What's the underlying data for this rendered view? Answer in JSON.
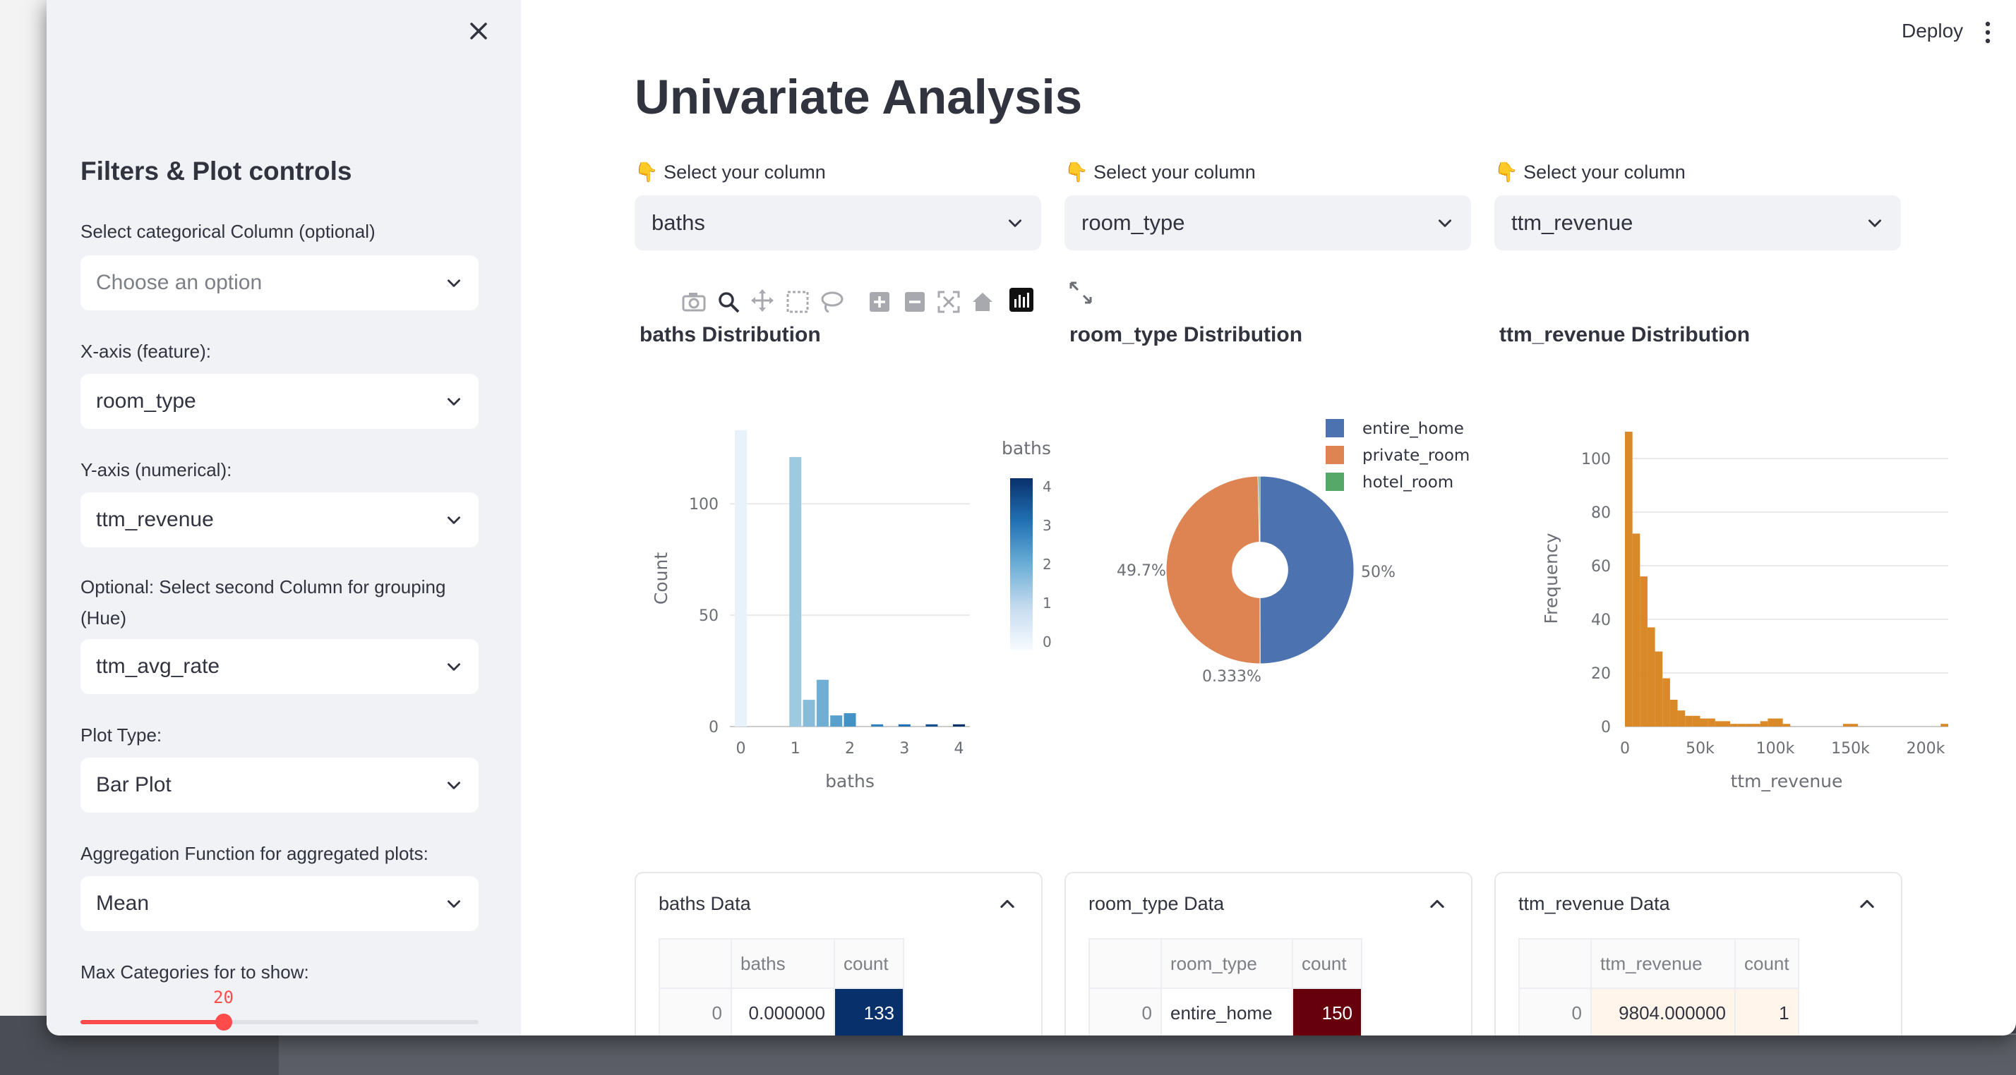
{
  "sidebar": {
    "heading": "Filters & Plot controls",
    "cat_label": "Select categorical Column (optional)",
    "cat_placeholder": "Choose an option",
    "x_label": "X-axis (feature):",
    "x_value": "room_type",
    "y_label": "Y-axis (numerical):",
    "y_value": "ttm_revenue",
    "hue_label": "Optional: Select second Column for grouping (Hue)",
    "hue_value": "ttm_avg_rate",
    "plot_label": "Plot Type:",
    "plot_value": "Bar Plot",
    "agg_label": "Aggregation Function for aggregated plots:",
    "agg_value": "Mean",
    "maxcat_label": "Max Categories for to show:",
    "maxcat_value": "20",
    "maxcat_fraction": 0.36
  },
  "header": {
    "deploy": "Deploy"
  },
  "main": {
    "title": "Univariate Analysis",
    "select_label": "👇 Select your column",
    "columns": [
      "baths",
      "room_type",
      "ttm_revenue"
    ],
    "chart_titles": [
      "baths Distribution",
      "room_type Distribution",
      "ttm_revenue Distribution"
    ],
    "expanders": [
      {
        "title": "baths Data",
        "headers": [
          "",
          "baths",
          "count"
        ],
        "row": [
          "0",
          "0.000000",
          "133"
        ]
      },
      {
        "title": "room_type Data",
        "headers": [
          "",
          "room_type",
          "count"
        ],
        "row": [
          "0",
          "entire_home",
          "150"
        ]
      },
      {
        "title": "ttm_revenue Data",
        "headers": [
          "",
          "ttm_revenue",
          "count"
        ],
        "row": [
          "0",
          "9804.000000",
          "1"
        ]
      }
    ]
  },
  "colors": {
    "accent": "#ff4b4b",
    "blue_dark": "#08306b",
    "orange": "#d98927",
    "maroon": "#67000d"
  },
  "chart_data": [
    {
      "type": "bar",
      "x": [
        0,
        1,
        1.25,
        1.5,
        1.75,
        2,
        2.5,
        3,
        3.5,
        4
      ],
      "values": [
        133,
        121,
        12,
        21,
        5,
        6,
        1,
        1,
        1,
        1
      ],
      "xlabel": "baths",
      "ylabel": "Count",
      "xticks": [
        "0",
        "1",
        "2",
        "3",
        "4"
      ],
      "yticks": [
        "0",
        "50",
        "100"
      ],
      "ylim": [
        0,
        133
      ],
      "colorbar": {
        "title": "baths",
        "ticks": [
          "0",
          "1",
          "2",
          "3",
          "4"
        ]
      }
    },
    {
      "type": "pie",
      "labels": [
        "entire_home",
        "private_room",
        "hotel_room"
      ],
      "values": [
        50,
        49.7,
        0.333
      ],
      "value_labels": [
        "50%",
        "49.7%",
        "0.333%"
      ],
      "colors": [
        "#4c72b0",
        "#dd8452",
        "#55a868"
      ],
      "hole": 0.3,
      "legend": "top-right"
    },
    {
      "type": "bar",
      "x": [
        2500,
        7500,
        12500,
        17500,
        22500,
        27500,
        32500,
        37500,
        42500,
        47500,
        52500,
        57500,
        62500,
        67500,
        72500,
        77500,
        82500,
        87500,
        92500,
        97500,
        102500,
        107500,
        147500,
        152500,
        212500
      ],
      "values": [
        110,
        72,
        56,
        37,
        28,
        18,
        10,
        6,
        4,
        4,
        3,
        3,
        2,
        2,
        1,
        1,
        1,
        1,
        2,
        3,
        3,
        1,
        1,
        1,
        1
      ],
      "xlabel": "ttm_revenue",
      "ylabel": "Frequency",
      "xticks": [
        "0",
        "50k",
        "100k",
        "150k",
        "200k"
      ],
      "yticks": [
        "0",
        "20",
        "40",
        "60",
        "80",
        "100"
      ],
      "xlim": [
        0,
        215000
      ],
      "ylim": [
        0,
        110
      ]
    }
  ]
}
